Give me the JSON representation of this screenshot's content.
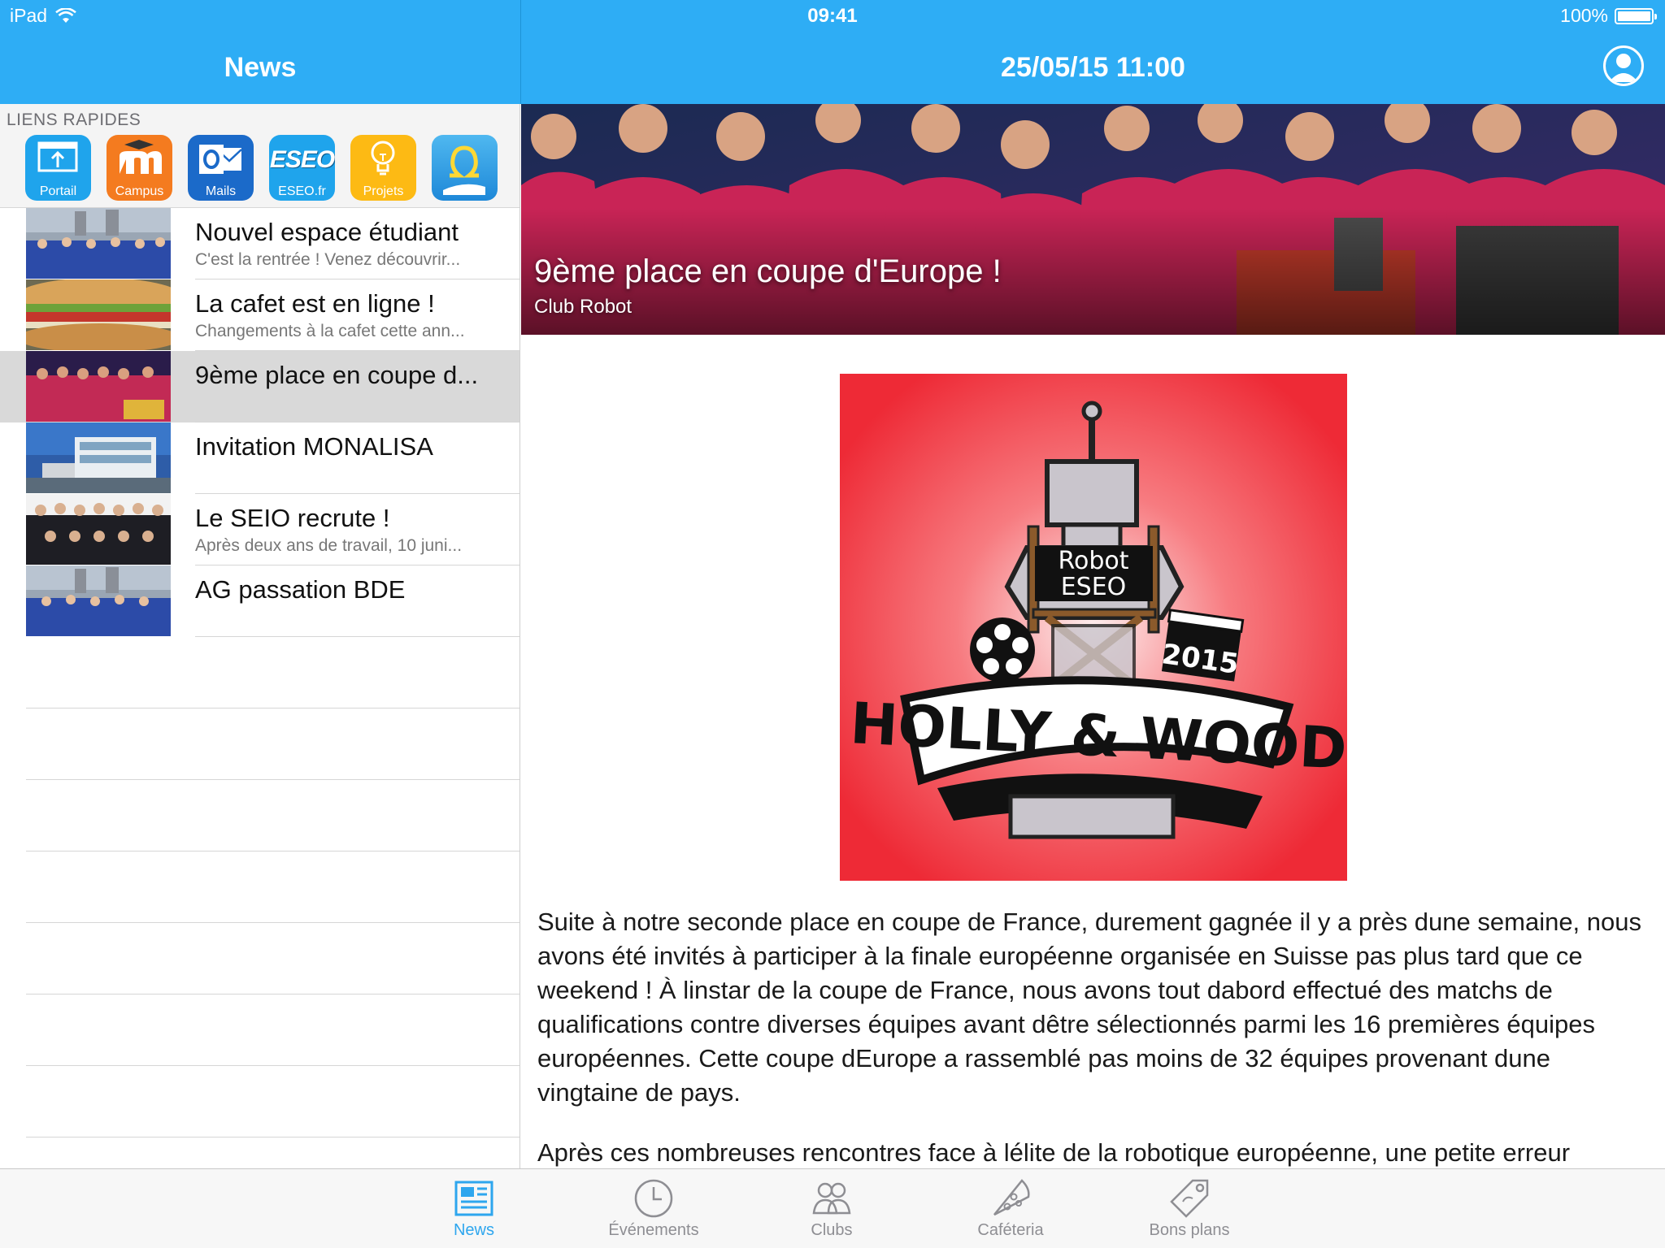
{
  "status_bar": {
    "device": "iPad",
    "time": "09:41",
    "battery": "100%"
  },
  "master": {
    "title": "News",
    "quick_links_header": "LIENS RAPIDES",
    "quick_links": [
      {
        "label": "Portail",
        "icon": "portal-upload-icon",
        "color": "#1FA4EC"
      },
      {
        "label": "Campus",
        "icon": "moodle-m-icon",
        "color": "#F47B1F"
      },
      {
        "label": "Mails",
        "icon": "outlook-mail-icon",
        "color": "#1B6AC9"
      },
      {
        "label": "ESEO.fr",
        "icon": "eseo-logo-icon",
        "color": "#1FA4EC"
      },
      {
        "label": "Projets",
        "icon": "lightbulb-icon",
        "color": "#FDBA14"
      },
      {
        "label": "",
        "icon": "omega-logo-icon",
        "color": "#2E9FE8"
      }
    ],
    "news": [
      {
        "title": "Nouvel espace étudiant",
        "subtitle": "C'est la rentrée ! Venez découvrir...",
        "selected": false
      },
      {
        "title": "La cafet est en ligne !",
        "subtitle": "Changements à la cafet cette ann...",
        "selected": false
      },
      {
        "title": "9ème place en coupe d...",
        "subtitle": "",
        "selected": true
      },
      {
        "title": "Invitation MONALISA",
        "subtitle": "",
        "selected": false
      },
      {
        "title": "Le SEIO recrute !",
        "subtitle": "Après deux ans de travail, 10 juni...",
        "selected": false
      },
      {
        "title": "AG passation BDE",
        "subtitle": "",
        "selected": false
      }
    ]
  },
  "detail": {
    "nav_title": "25/05/15 11:00",
    "hero_title": "9ème place en coupe d'Europe !",
    "hero_subtitle": "Club Robot",
    "poster": {
      "top_text_1": "Robot",
      "top_text_2": "ESEO",
      "year": "2015",
      "banner": "HOLLY & WOOD"
    },
    "paragraphs": [
      "Suite à notre seconde place en coupe de France, durement gagnée il y a près dune semaine, nous avons été invités à participer à la finale européenne organisée en Suisse pas plus tard que ce weekend ! À linstar de la coupe de France, nous avons tout dabord effectué des matchs de qualifications contre diverses équipes avant dêtre sélectionnés parmi les 16 premières équipes européennes. Cette coupe dEurope a rassemblé pas moins de 32 équipes provenant dune vingtaine de pays.",
      "Après ces nombreuses rencontres face à lélite de la robotique européenne, une petite erreur"
    ]
  },
  "tabs": [
    {
      "label": "News",
      "icon": "newspaper-icon",
      "active": true
    },
    {
      "label": "Événements",
      "icon": "clock-icon",
      "active": false
    },
    {
      "label": "Clubs",
      "icon": "people-icon",
      "active": false
    },
    {
      "label": "Caféteria",
      "icon": "pizza-slice-icon",
      "active": false
    },
    {
      "label": "Bons plans",
      "icon": "price-tag-icon",
      "active": false
    }
  ],
  "colors": {
    "accent": "#2EADF5",
    "tab_active": "#2EA6EE",
    "tab_inactive": "#8E8E93",
    "selected_row": "#D9D9D9"
  }
}
